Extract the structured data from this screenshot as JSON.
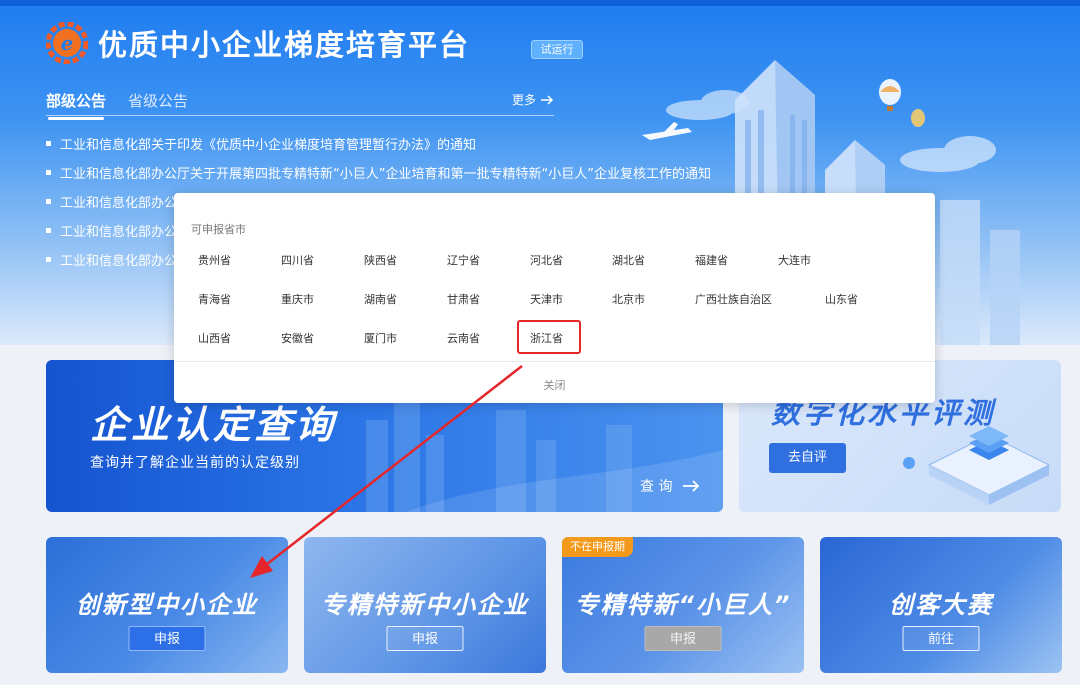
{
  "header": {
    "title": "优质中小企业梯度培育平台",
    "badge": "试运行"
  },
  "tabs": [
    {
      "label": "部级公告",
      "active": true
    },
    {
      "label": "省级公告",
      "active": false
    }
  ],
  "more_label": "更多",
  "notices": [
    "工业和信息化部关于印发《优质中小企业梯度培育管理暂行办法》的通知",
    "工业和信息化部办公厅关于开展第四批专精特新“小巨人”企业培育和第一批专精特新“小巨人”企业复核工作的通知",
    "工业和信息化部办公",
    "工业和信息化部办公",
    "工业和信息化部办公"
  ],
  "popup": {
    "title": "可申报省市",
    "regions": [
      "贵州省",
      "四川省",
      "陕西省",
      "辽宁省",
      "河北省",
      "湖北省",
      "福建省",
      "大连市",
      "青海省",
      "重庆市",
      "湖南省",
      "甘肃省",
      "天津市",
      "北京市",
      "广西壮族自治区",
      "山东省",
      "山西省",
      "安徽省",
      "厦门市",
      "云南省",
      "浙江省"
    ],
    "highlighted": "浙江省",
    "close_label": "关闭"
  },
  "query_card": {
    "title": "企业认定查询",
    "subtitle": "查询并了解企业当前的认定级别",
    "link_label": "查 询"
  },
  "digital_card": {
    "title": "数字化水平评测",
    "button_label": "去自评"
  },
  "bottom_cards": [
    {
      "title": "创新型中小企业",
      "button": "申报",
      "tag": null
    },
    {
      "title": "专精特新中小企业",
      "button": "申报",
      "tag": null
    },
    {
      "title": "专精特新“小巨人”",
      "button": "申报",
      "tag": "不在申报期"
    },
    {
      "title": "创客大赛",
      "button": "前往",
      "tag": null
    }
  ],
  "colors": {
    "primary": "#2f6fe0",
    "hero_top": "#1f7cf0",
    "highlight_red": "#e5262b",
    "tag_orange": "#f39a1c",
    "disabled_gray": "#a8a8a8"
  },
  "icons": {
    "logo": "e-gear-logo-icon",
    "more": "arrow-right-icon",
    "query": "arrow-right-icon"
  }
}
